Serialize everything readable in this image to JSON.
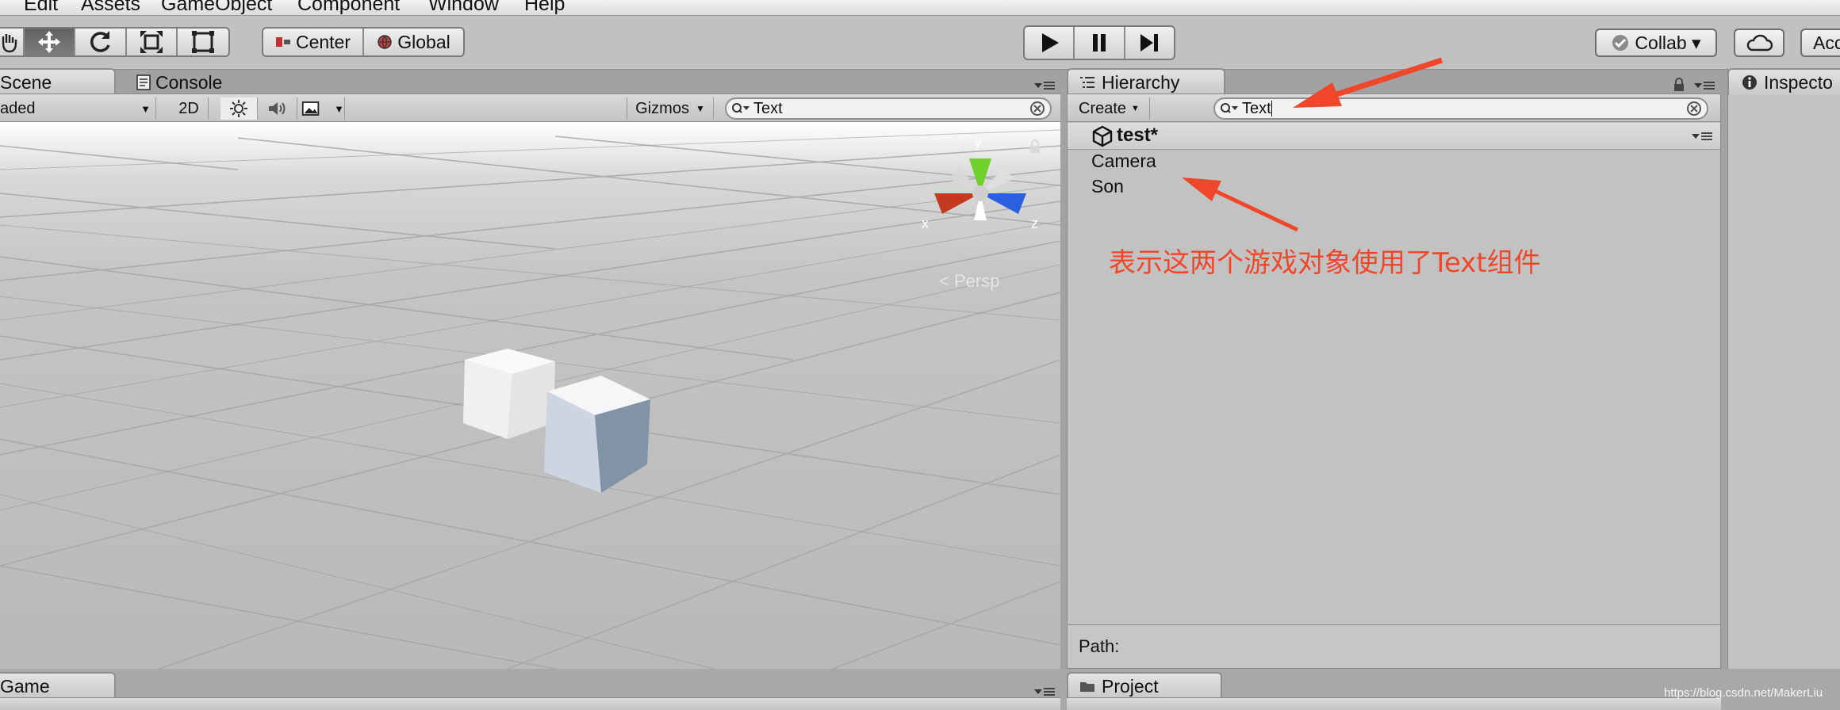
{
  "menu": [
    "Edit",
    "Assets",
    "GameObject",
    "Component",
    "Window",
    "Help"
  ],
  "toolbar": {
    "tools": [
      {
        "icon": "hand-icon"
      },
      {
        "icon": "move-icon"
      },
      {
        "icon": "rotate-icon"
      },
      {
        "icon": "scale-icon"
      },
      {
        "icon": "rect-icon"
      }
    ],
    "pivot_label": "Center",
    "space_label": "Global",
    "collab_label": "Collab ▾",
    "account_label": "Acc"
  },
  "tabs": {
    "scene": "Scene",
    "console": "Console",
    "hierarchy": "Hierarchy",
    "inspector": "Inspecto",
    "game": "Game",
    "project": "Project"
  },
  "scenebar": {
    "shading": "aded",
    "mode_2d": "2D",
    "gizmos": "Gizmos",
    "search_value": "Text"
  },
  "gizmo": {
    "x_label": "x",
    "y_label": "y",
    "z_label": "z",
    "persp_label": "< Persp"
  },
  "hierarchy": {
    "create_label": "Create",
    "search_value": "Text",
    "scene_name": "test*",
    "items": [
      "Camera",
      "Son"
    ],
    "path_label": "Path:"
  },
  "annotation": {
    "text": "表示这两个游戏对象使用了Text组件",
    "color": "#f0472a"
  },
  "watermark": "https://blog.csdn.net/MakerLiu"
}
